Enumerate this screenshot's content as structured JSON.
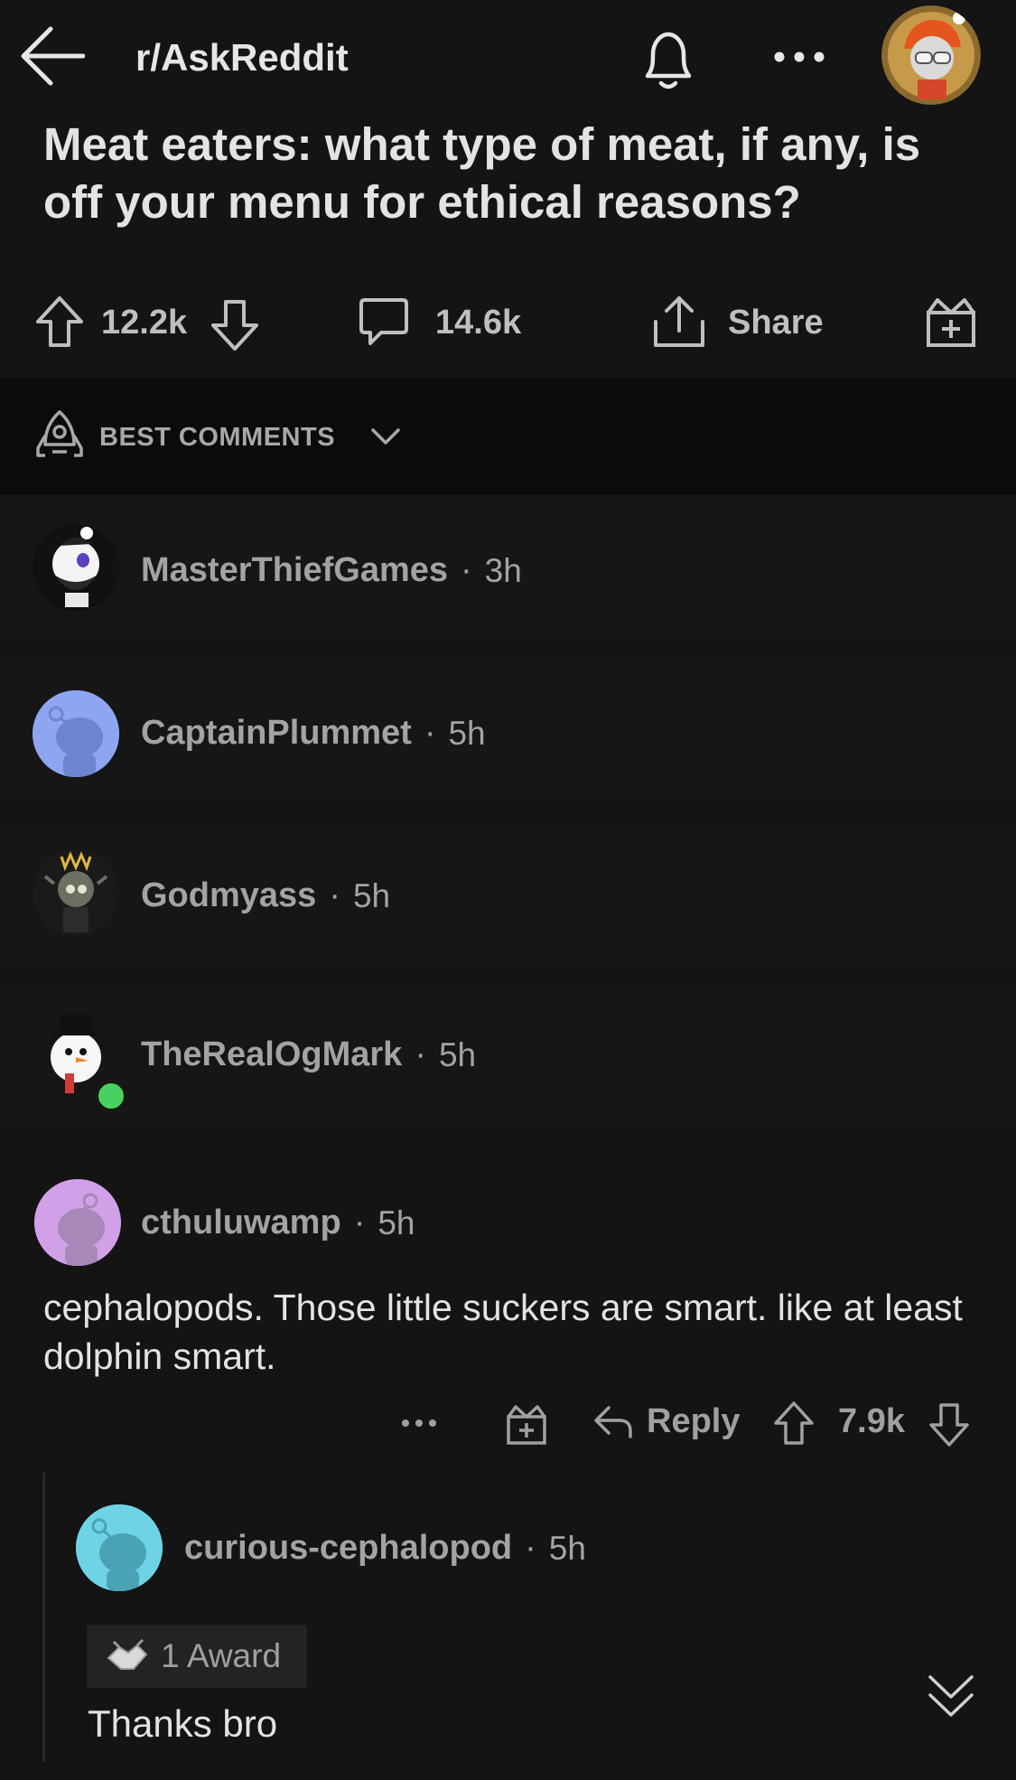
{
  "header": {
    "subreddit": "r/AskReddit",
    "icons": [
      "back-arrow-icon",
      "bell-icon",
      "more-icon",
      "profile-avatar"
    ]
  },
  "post": {
    "title": "Meat eaters: what type of meat, if any, is off your menu for ethical reasons?",
    "upvotes": "12.2k",
    "comments": "14.6k",
    "share_label": "Share"
  },
  "sort": {
    "label": "BEST COMMENTS"
  },
  "collapsed_comments": [
    {
      "user": "MasterThiefGames",
      "time": "3h"
    },
    {
      "user": "CaptainPlummet",
      "time": "5h"
    },
    {
      "user": "Godmyass",
      "time": "5h"
    },
    {
      "user": "TheRealOgMark",
      "time": "5h"
    }
  ],
  "comment": {
    "user": "cthuluwamp",
    "time": "5h",
    "text": "cephalopods. Those little suckers are smart. like at least dolphin smart.",
    "reply_label": "Reply",
    "votes": "7.9k"
  },
  "reply": {
    "user": "curious-cephalopod",
    "time": "5h",
    "award": "1 Award",
    "text": "Thanks bro"
  },
  "colors": {
    "background": "#141414",
    "sort_bar": "#0b0b0b",
    "online": "#46d160"
  }
}
